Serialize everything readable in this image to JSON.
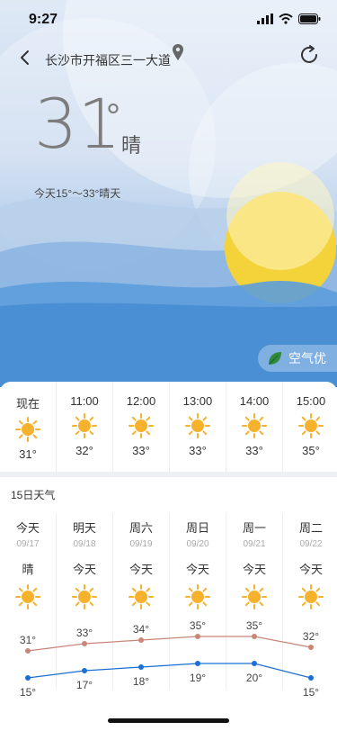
{
  "status_bar": {
    "time": "9:27"
  },
  "header": {
    "location": "长沙市开福区三一大道"
  },
  "current": {
    "temperature": "31",
    "degree_symbol": "°",
    "condition": "晴",
    "today_range": "今天15°～33°晴天"
  },
  "air_quality": {
    "label": "空气优"
  },
  "hourly": [
    {
      "time": "现在",
      "temp": "31°",
      "icon": "sun-icon"
    },
    {
      "time": "11:00",
      "temp": "32°",
      "icon": "sun-icon"
    },
    {
      "time": "12:00",
      "temp": "33°",
      "icon": "sun-icon"
    },
    {
      "time": "13:00",
      "temp": "33°",
      "icon": "sun-icon"
    },
    {
      "time": "14:00",
      "temp": "33°",
      "icon": "sun-icon"
    },
    {
      "time": "15:00",
      "temp": "35°",
      "icon": "sun-icon"
    }
  ],
  "daily_title": "15日天气",
  "daily": [
    {
      "day": "今天",
      "date": "09/17",
      "condition": "晴",
      "high": "31°",
      "low": "15°",
      "high_val": 31,
      "low_val": 15
    },
    {
      "day": "明天",
      "date": "09/18",
      "condition": "今天",
      "high": "33°",
      "low": "17°",
      "high_val": 33,
      "low_val": 17
    },
    {
      "day": "周六",
      "date": "09/19",
      "condition": "今天",
      "high": "34°",
      "low": "18°",
      "high_val": 34,
      "low_val": 18
    },
    {
      "day": "周日",
      "date": "09/20",
      "condition": "今天",
      "high": "35°",
      "low": "19°",
      "high_val": 35,
      "low_val": 19
    },
    {
      "day": "周一",
      "date": "09/21",
      "condition": "今天",
      "high": "35°",
      "low": "20°",
      "high_val": 35,
      "low_val": 19
    },
    {
      "day": "周二",
      "date": "09/22",
      "condition": "今天",
      "high": "32°",
      "low": "15°",
      "high_val": 32,
      "low_val": 15
    }
  ],
  "colors": {
    "high_line": "#c98678",
    "low_line": "#1a6fd6",
    "sun": "#f6b12d",
    "sky": "#4a90d6"
  }
}
